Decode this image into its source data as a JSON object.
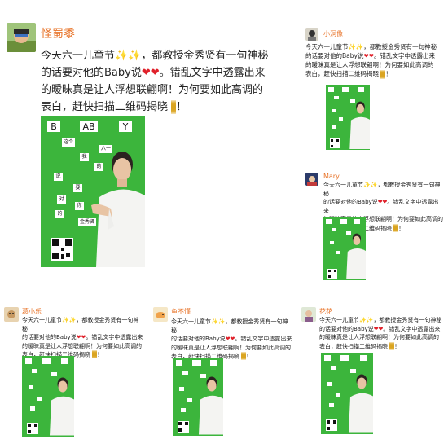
{
  "main_post": {
    "username": "怪蜀黍",
    "text_line1": "今天六一儿童节",
    "text_line1b": "，都教授金秀贤有一句神秘",
    "text_line2a": "的话要对他的Baby说",
    "text_line2b": "。错乱文字中透露出来",
    "text_line3": "的暧昧真是让人浮想联翩啊！为何要如此高调的",
    "text_line4": "表白，赶快扫描二维码揭晓",
    "text_end": "！",
    "card": {
      "title_letters": [
        "B",
        "AB",
        "Y"
      ],
      "chips": [
        "这个",
        "六一",
        "我",
        "的",
        "说",
        "要",
        "对",
        "你",
        "的",
        "金秀贤"
      ]
    }
  },
  "reposts": [
    {
      "username": "小洞像"
    },
    {
      "username": "Mary"
    },
    {
      "username": "葛小乐"
    },
    {
      "username": "鱼不懂"
    },
    {
      "username": "花花"
    }
  ],
  "repost_text": {
    "line1a": "今天六一儿童节",
    "line1b": "，都教授金秀贤有一句神秘",
    "line2a": "的话要对他的Baby说",
    "line2b": "。错乱文字中透露出来",
    "line3": "的暧昧真是让人浮想联翩啊！为何要如此高调的",
    "line4": "表白，赶快扫描二维码揭晓",
    "end": "！"
  },
  "colors": {
    "card_green": "#3cb53c",
    "username_orange": "#e8742a",
    "heart_red": "#e0202a"
  }
}
